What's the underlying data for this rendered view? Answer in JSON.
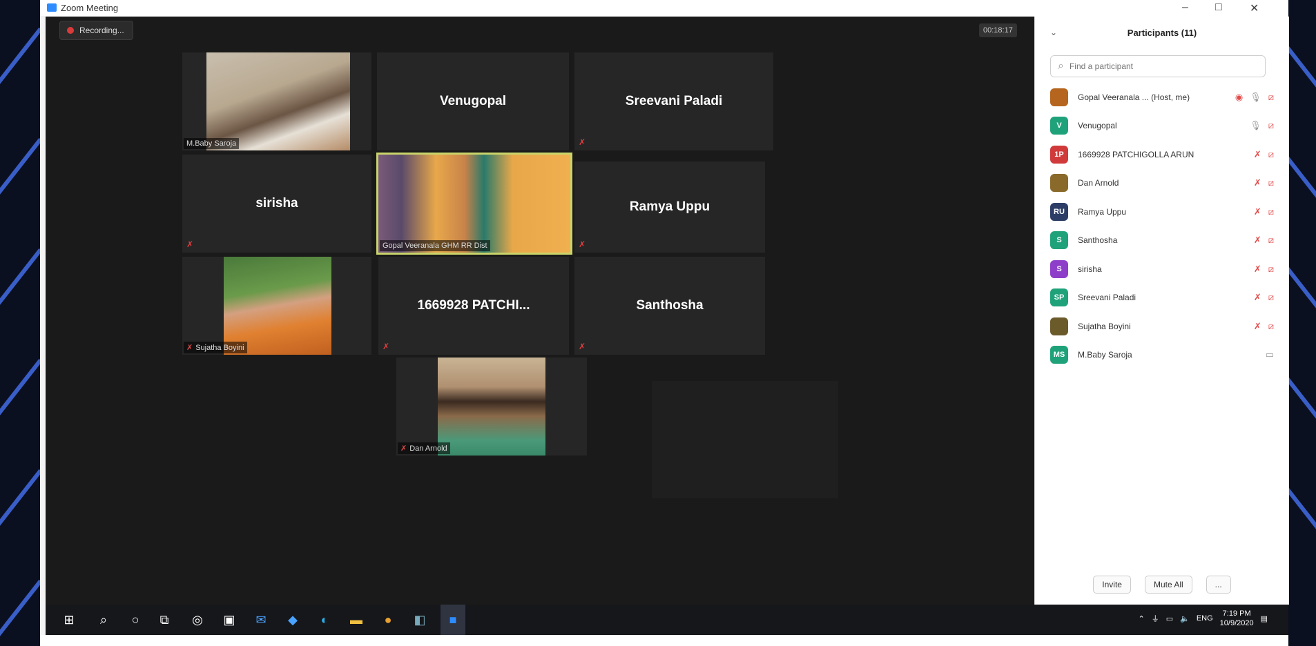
{
  "window": {
    "title": "Zoom Meeting",
    "min": "–",
    "max": "□",
    "close": "✕"
  },
  "meeting": {
    "recording_label": "Recording...",
    "timer": "00:18:17"
  },
  "tiles": [
    {
      "name": "",
      "label": "M.Baby Saroja"
    },
    {
      "name": "Venugopal",
      "label": ""
    },
    {
      "name": "Sreevani Paladi",
      "label": ""
    },
    {
      "name": "sirisha",
      "label": ""
    },
    {
      "name": "",
      "label": "Gopal Veeranala GHM RR Dist"
    },
    {
      "name": "Ramya Uppu",
      "label": ""
    },
    {
      "name": "",
      "label": "Sujatha Boyini"
    },
    {
      "name": "1669928 PATCHI...",
      "label": ""
    },
    {
      "name": "Santhosha",
      "label": ""
    },
    {
      "name": "",
      "label": "Dan Arnold"
    }
  ],
  "participants": {
    "title": "Participants (11)",
    "search_placeholder": "Find a participant",
    "list": [
      {
        "initials": "",
        "name": "Gopal Veeranala ... (Host, me)",
        "color": "#b5651d"
      },
      {
        "initials": "V",
        "name": "Venugopal",
        "color": "#1fa27a"
      },
      {
        "initials": "1P",
        "name": "1669928 PATCHIGOLLA ARUN",
        "color": "#d13a3a"
      },
      {
        "initials": "",
        "name": "Dan Arnold",
        "color": "#8a6a2a"
      },
      {
        "initials": "RU",
        "name": "Ramya Uppu",
        "color": "#2c3e66"
      },
      {
        "initials": "S",
        "name": "Santhosha",
        "color": "#1fa27a"
      },
      {
        "initials": "S",
        "name": "sirisha",
        "color": "#8e3fc9"
      },
      {
        "initials": "SP",
        "name": "Sreevani Paladi",
        "color": "#1fa27a"
      },
      {
        "initials": "",
        "name": "Sujatha Boyini",
        "color": "#6b5a2a"
      },
      {
        "initials": "MS",
        "name": "M.Baby Saroja",
        "color": "#1fa27a"
      }
    ],
    "invite": "Invite",
    "mute_all": "Mute All",
    "more": "..."
  },
  "taskbar": {
    "lang": "ENG",
    "time": "7:19 PM",
    "date": "10/9/2020"
  }
}
